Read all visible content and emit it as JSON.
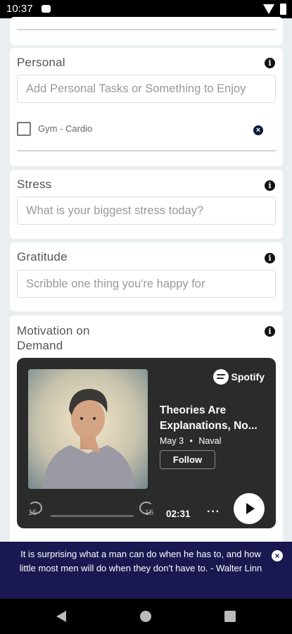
{
  "status_bar": {
    "time": "10:37"
  },
  "personal": {
    "title": "Personal",
    "placeholder": "Add Personal Tasks or Something to Enjoy",
    "tasks": [
      {
        "label": "Gym - Cardio",
        "checked": false
      }
    ]
  },
  "stress": {
    "title": "Stress",
    "placeholder": "What is your biggest stress today?"
  },
  "gratitude": {
    "title": "Gratitude",
    "placeholder": "Scribble one thing you're happy for"
  },
  "motivation": {
    "title_line1": "Motivation on",
    "title_line2": "Demand",
    "player": {
      "brand": "Spotify",
      "episode_title_line1": "Theories Are",
      "episode_title_line2": "Explanations, No...",
      "date": "May 3",
      "separator": "•",
      "show": "Naval",
      "follow_label": "Follow",
      "skip_back_label": "15",
      "skip_forward_label": "15",
      "time_remaining": "02:31",
      "more_label": "···",
      "progress_fraction": 0
    }
  },
  "quote": {
    "text": "It is surprising what a man can do when he has to, and how little most men will do when they don't have to. - Walter Linn"
  },
  "icons": {
    "info": "info-icon",
    "close": "close-icon",
    "play": "play-icon"
  },
  "colors": {
    "page_background": "#e9eef0",
    "quote_bar": "#1a1850",
    "player_background": "#2b2b2b",
    "remove_task": "#0d1b3e"
  }
}
